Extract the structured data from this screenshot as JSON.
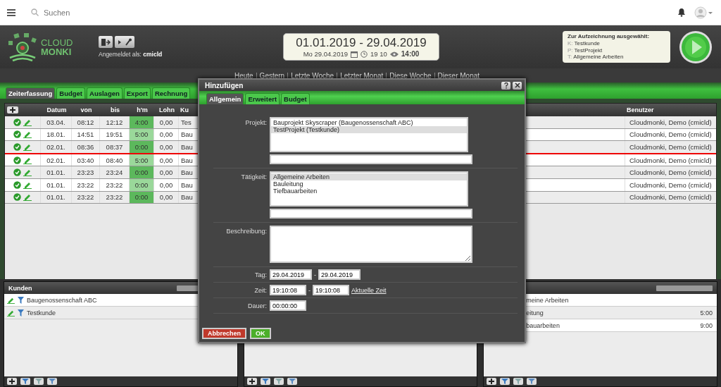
{
  "topbar": {
    "search_placeholder": "Suchen"
  },
  "header": {
    "logo": [
      "CLOUD",
      "MONKI"
    ],
    "login_label": "Angemeldet als:",
    "login_user": "cmicld",
    "range": "01.01.2019 - 29.04.2019",
    "day": "Mo 29.04.2019",
    "time": "19 10",
    "total": "14:00",
    "selection": {
      "title": "Zur Aufzeichnung ausgewählt:",
      "lines": [
        {
          "prefix": "K:",
          "value": "Testkunde"
        },
        {
          "prefix": "P:",
          "value": "TestProjekt"
        },
        {
          "prefix": "T:",
          "value": "Allgemeine Arbeiten"
        }
      ]
    }
  },
  "quick_links": [
    "Heute",
    "Gestern",
    "Letzte Woche",
    "Letzter Monat",
    "Diese Woche",
    "Dieser Monat"
  ],
  "tabs": [
    {
      "label": "Zeiterfassung",
      "selected": true
    },
    {
      "label": "Budget",
      "selected": false
    },
    {
      "label": "Auslagen",
      "selected": false
    },
    {
      "label": "Export",
      "selected": false
    },
    {
      "label": "Rechnung",
      "selected": false
    }
  ],
  "table": {
    "columns": [
      "Datum",
      "von",
      "bis",
      "h'm",
      "Lohn",
      "Ku",
      "Benutzer"
    ],
    "rows": [
      {
        "cells": [
          "03.04.",
          "08:12",
          "12:12",
          "4:00",
          "0,00",
          "Tes"
        ],
        "user": "Cloudmonki, Demo (cmicld)",
        "marker": false
      },
      {
        "cells": [
          "18.01.",
          "14:51",
          "19:51",
          "5:00",
          "0,00",
          "Bau"
        ],
        "user": "Cloudmonki, Demo (cmicld)",
        "marker": false
      },
      {
        "cells": [
          "02.01.",
          "08:36",
          "08:37",
          "0:00",
          "0,00",
          "Bau"
        ],
        "user": "Cloudmonki, Demo (cmicld)",
        "marker": true
      },
      {
        "cells": [
          "02.01.",
          "03:40",
          "08:40",
          "5:00",
          "0,00",
          "Bau"
        ],
        "user": "Cloudmonki, Demo (cmicld)",
        "marker": false
      },
      {
        "cells": [
          "01.01.",
          "23:23",
          "23:24",
          "0:00",
          "0,00",
          "Bau"
        ],
        "user": "Cloudmonki, Demo (cmicld)",
        "marker": false
      },
      {
        "cells": [
          "01.01.",
          "23:22",
          "23:22",
          "0:00",
          "0,00",
          "Bau"
        ],
        "user": "Cloudmonki, Demo (cmicld)",
        "marker": false
      },
      {
        "cells": [
          "01.01.",
          "23:22",
          "23:22",
          "0:00",
          "0,00",
          "Bau"
        ],
        "user": "Cloudmonki, Demo (cmicld)",
        "marker": false
      }
    ]
  },
  "customers": {
    "title": "Kunden",
    "items": [
      "Baugenossenschaft ABC",
      "Testkunde"
    ]
  },
  "activities": {
    "items": [
      {
        "name": "meine Arbeiten"
      },
      {
        "name": "eitung",
        "time": "5:00"
      },
      {
        "name": "bauarbeiten",
        "time": "9:00"
      }
    ]
  },
  "dialog": {
    "title": "Hinzufügen",
    "tabs": [
      {
        "label": "Allgemein",
        "selected": true
      },
      {
        "label": "Erweitert",
        "selected": false
      },
      {
        "label": "Budget",
        "selected": false
      }
    ],
    "project_label": "Projekt:",
    "projects": [
      {
        "label": "Bauprojekt Skyscraper (Baugenossenschaft ABC)",
        "selected": false
      },
      {
        "label": "TestProjekt (Testkunde)",
        "selected": true
      }
    ],
    "activity_label": "Tätigkeit:",
    "activities": [
      {
        "label": "Allgemeine Arbeiten",
        "selected": true
      },
      {
        "label": "Bauleitung",
        "selected": false
      },
      {
        "label": "Tiefbauarbeiten",
        "selected": false
      }
    ],
    "description_label": "Beschreibung:",
    "day_label": "Tag:",
    "day_from": "29.04.2019",
    "day_to": "29.04.2019",
    "time_label": "Zeit:",
    "time_from": "19:10:08",
    "time_to": "19:10:08",
    "now_link": "Aktuelle Zeit",
    "duration_label": "Dauer:",
    "duration": "00:00:00",
    "separator": "-",
    "cancel": "Abbrechen",
    "ok": "OK"
  }
}
